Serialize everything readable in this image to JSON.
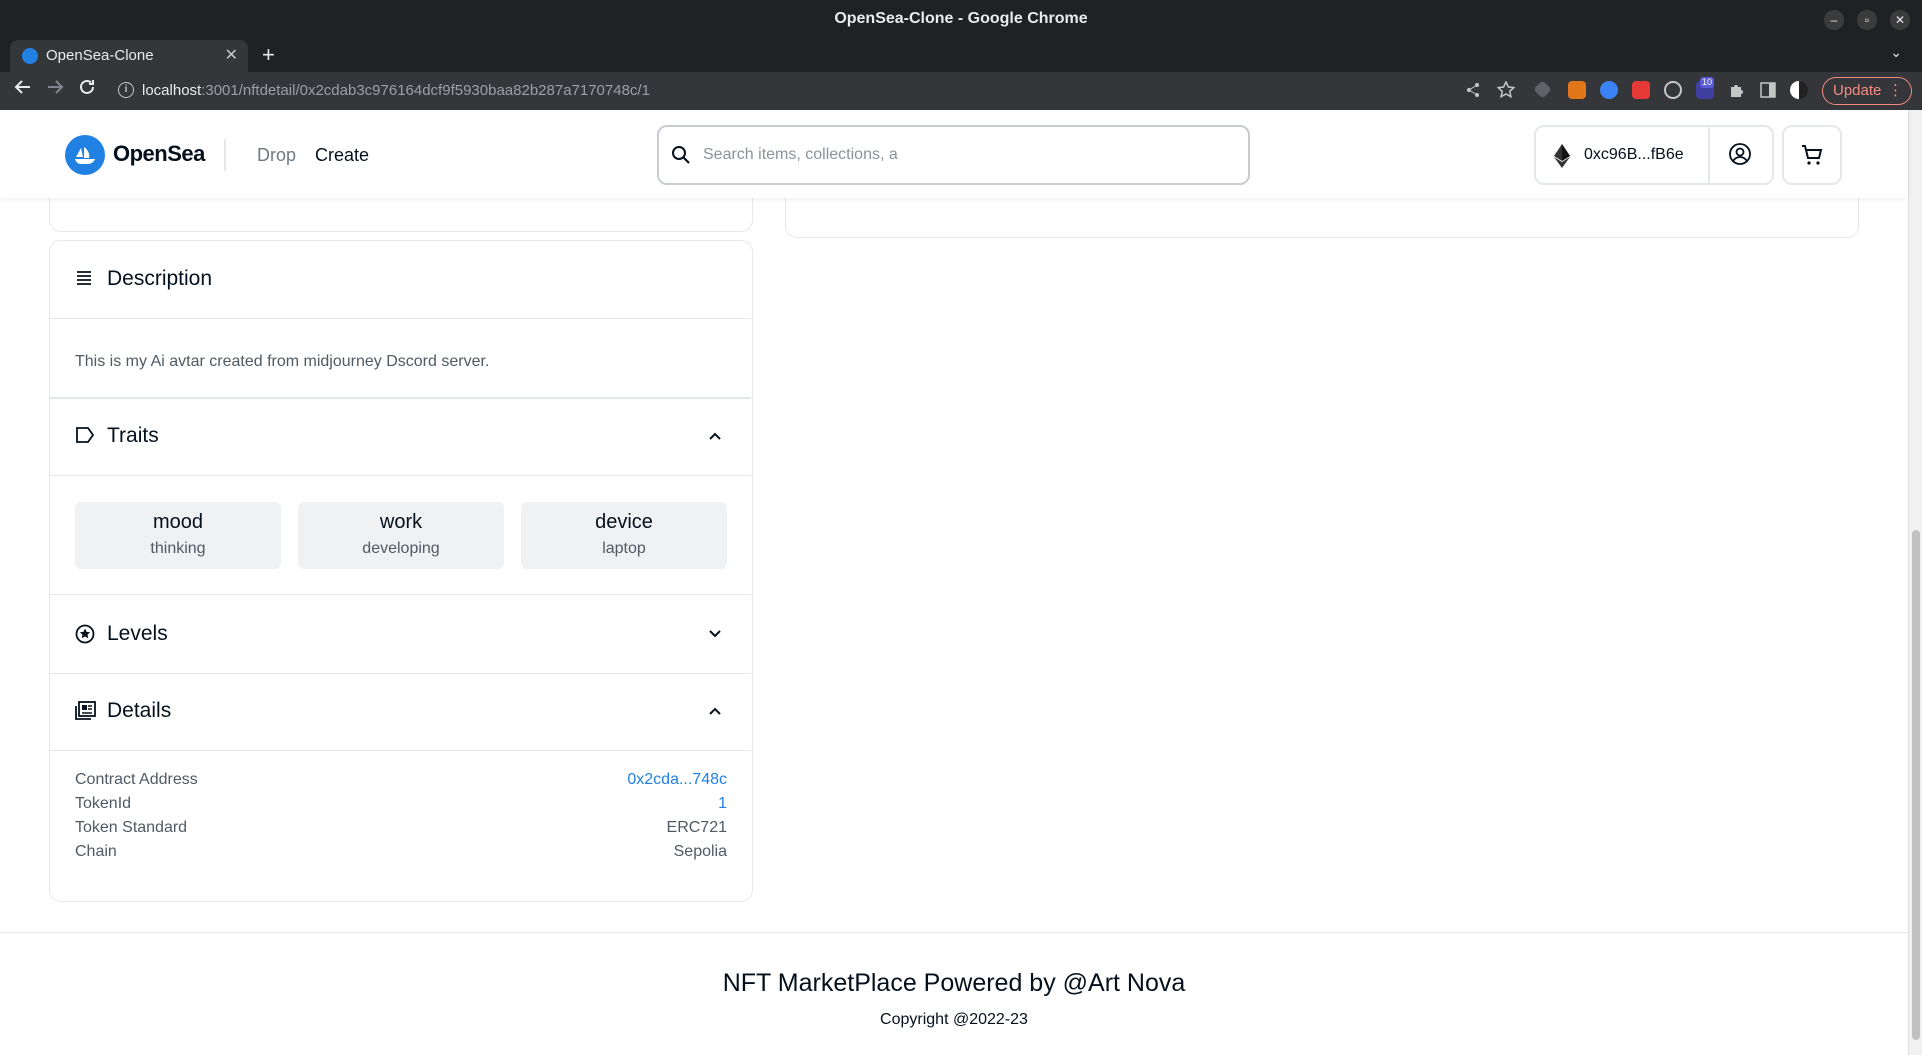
{
  "window": {
    "title": "OpenSea-Clone - Google Chrome",
    "min": "–",
    "max": "▫",
    "close": "✕"
  },
  "tab": {
    "title": "OpenSea-Clone",
    "close": "✕",
    "new": "+",
    "menu": "⌄"
  },
  "toolbar": {
    "url_host": "localhost",
    "url_path": ":3001/nftdetail/0x2cdab3c976164dcf9f5930baa82b287a7170748c/1",
    "extension_badge": "10",
    "update_label": "Update"
  },
  "header": {
    "logo_text": "OpenSea",
    "nav": {
      "drop": "Drop",
      "create": "Create"
    },
    "search_placeholder": "Search items, collections, a",
    "wallet_address": "0xc96B...fB6e"
  },
  "description": {
    "title": "Description",
    "text": "This is my Ai avtar created from midjourney Dscord server."
  },
  "traits": {
    "title": "Traits",
    "items": [
      {
        "name": "mood",
        "value": "thinking"
      },
      {
        "name": "work",
        "value": "developing"
      },
      {
        "name": "device",
        "value": "laptop"
      }
    ]
  },
  "levels": {
    "title": "Levels"
  },
  "details": {
    "title": "Details",
    "rows": [
      {
        "label": "Contract Address",
        "value": "0x2cda...748c"
      },
      {
        "label": "TokenId",
        "value": "1"
      },
      {
        "label": "Token Standard",
        "value": "ERC721"
      },
      {
        "label": "Chain",
        "value": "Sepolia"
      }
    ]
  },
  "footer": {
    "title": "NFT MarketPlace Powered by @Art Nova",
    "copyright": "Copyright @2022-23"
  },
  "colors": {
    "brand": "#2081e2",
    "text": "#04111d",
    "muted": "#4f5a65",
    "border": "#e5e8eb"
  }
}
